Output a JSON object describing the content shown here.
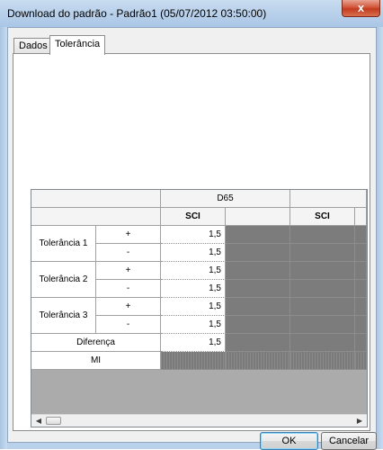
{
  "window": {
    "title": "Download do padrão - Padrão1 (05/07/2012 03:50:00)",
    "close_label": "x"
  },
  "tabs": [
    {
      "label": "Dados"
    },
    {
      "label": "Tolerância"
    }
  ],
  "grid": {
    "illuminant": "D65",
    "subheader": "SCI",
    "rows": [
      {
        "group": "Tolerância 1",
        "sign_plus": "+",
        "sign_minus": "-",
        "plus": "1,5",
        "minus": "1,5"
      },
      {
        "group": "Tolerância 2",
        "sign_plus": "+",
        "sign_minus": "-",
        "plus": "1,5",
        "minus": "1,5"
      },
      {
        "group": "Tolerância 3",
        "sign_plus": "+",
        "sign_minus": "-",
        "plus": "1,5",
        "minus": "1,5"
      }
    ],
    "difference_label": "Diferença",
    "difference_value": "1,5",
    "mi_label": "MI"
  },
  "scrollbar": {
    "left_arrow": "◀",
    "right_arrow": "▶"
  },
  "buttons": {
    "ok": "OK",
    "cancel": "Cancelar"
  }
}
